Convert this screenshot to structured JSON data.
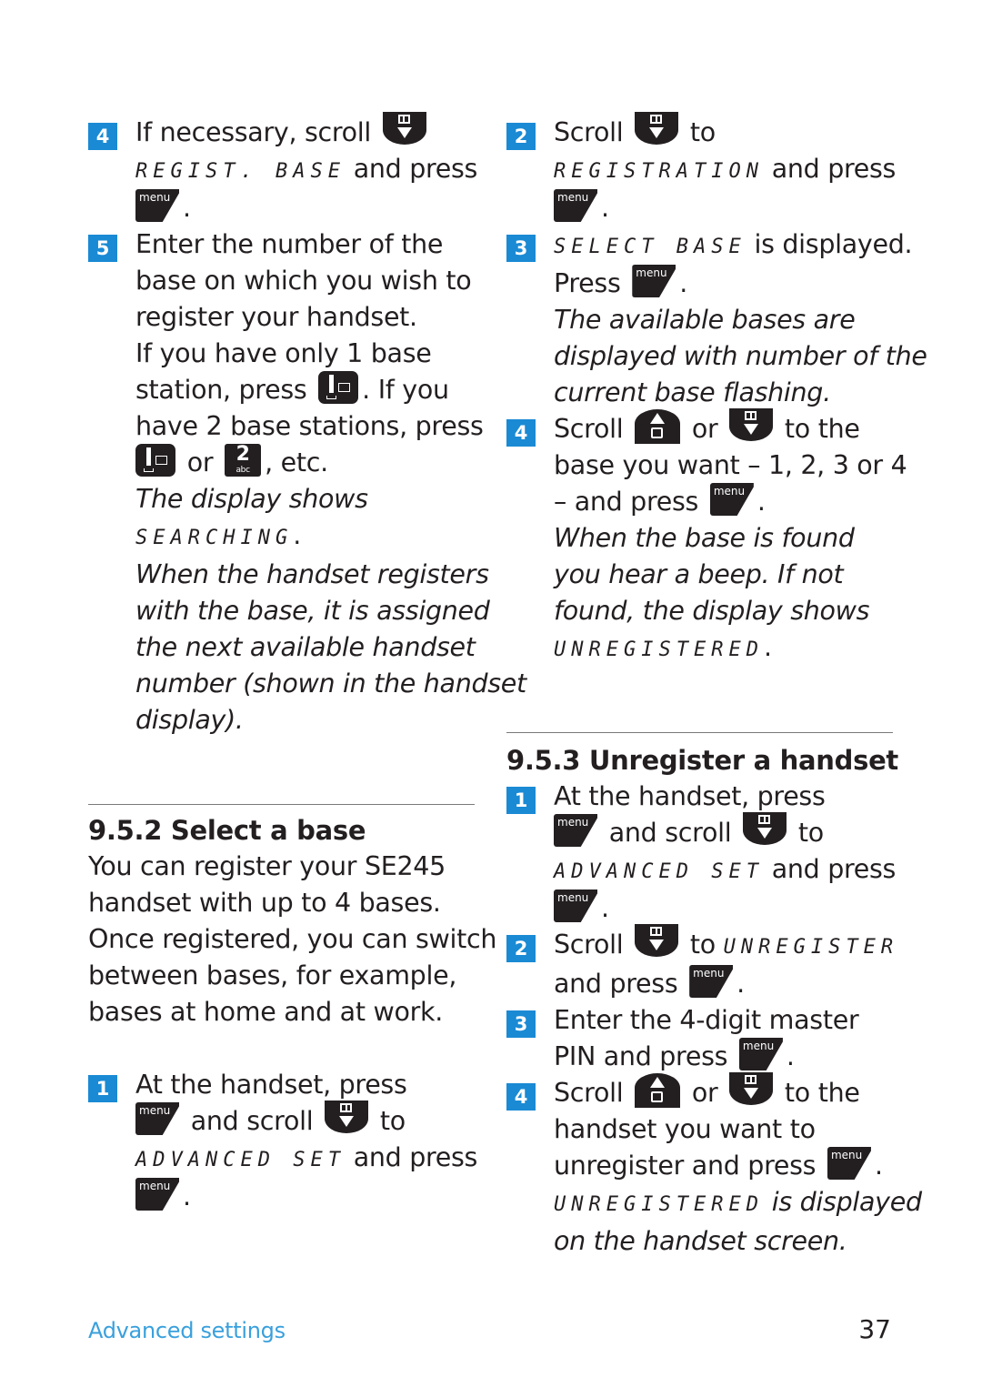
{
  "left_column": {
    "step4": {
      "number": "4",
      "line1": "If necessary, scroll",
      "lcd": "REGIST. BASE",
      "line2_tail": " and press",
      "end": "."
    },
    "step5": {
      "number": "5",
      "lines": [
        "Enter the number of the",
        "base on which you wish to",
        "register your handset.",
        "If you have only 1 base"
      ],
      "station_press": "station, press ",
      "if_you": ". If you",
      "have2": "have 2 base stations, press",
      "or": " or ",
      "etc": ", etc.",
      "key_two_num": "2",
      "key_two_sub": "abc",
      "display_shows": "The display shows",
      "lcd": "SEARCHING",
      "lcd_end": ".",
      "note_lines": [
        "When the handset registers",
        "with the base, it is assigned",
        "the next available handset",
        "number (shown in the handset",
        "display)."
      ]
    },
    "section_952": {
      "heading": "9.5.2 Select a base",
      "para_lines": [
        "You can register your SE245",
        "handset with up to 4 bases.",
        "Once registered, you can switch",
        "between bases, for example,",
        "bases at home and at work."
      ],
      "step1": {
        "number": "1",
        "line1": "At the handset, press",
        "and_scroll": " and scroll ",
        "to": " to",
        "lcd": "ADVANCED SET",
        "and_press": " and press",
        "end": "."
      }
    }
  },
  "right_column": {
    "step2": {
      "number": "2",
      "scroll": "Scroll ",
      "to": " to",
      "lcd": "REGISTRATION",
      "and_press": " and press",
      "end": "."
    },
    "step3": {
      "number": "3",
      "lcd": "SELECT BASE",
      "is_displayed": " is displayed.",
      "press": "Press ",
      "end": ".",
      "note_lines": [
        "The available bases are",
        "displayed with number of the",
        "current base flashing."
      ]
    },
    "step4": {
      "number": "4",
      "scroll": "Scroll ",
      "or": " or ",
      "to_the": " to the",
      "line2": "base you want – 1, 2, 3 or 4",
      "line3": "– and press ",
      "end": ".",
      "note_lines": [
        "When the base is found",
        "you hear a beep. If not",
        "found, the display shows"
      ],
      "lcd": "UNREGISTERED",
      "lcd_end": "."
    },
    "section_953": {
      "heading": "9.5.3 Unregister a handset",
      "step1": {
        "number": "1",
        "line1": "At the handset, press",
        "and_scroll": " and scroll ",
        "to": " to",
        "lcd": "ADVANCED SET",
        "and_press": " and press",
        "end": "."
      },
      "step2": {
        "number": "2",
        "scroll": "Scroll ",
        "to": " to ",
        "lcd": "UNREGISTER",
        "and_press": "and press ",
        "end": "."
      },
      "step3": {
        "number": "3",
        "line1": "Enter the 4-digit master",
        "line2": "PIN and press ",
        "end": "."
      },
      "step4": {
        "number": "4",
        "scroll": "Scroll ",
        "or": " or ",
        "to_the": " to the",
        "line2": "handset you want to",
        "line3": "unregister and press ",
        "end": ".",
        "lcd": "UNREGISTERED",
        "is_displayed": " is displayed",
        "last": "on the handset screen."
      }
    }
  },
  "keys": {
    "menu_label": "menu"
  },
  "footer": {
    "section": "Advanced settings",
    "page_number": "37"
  },
  "colors": {
    "badge_blue": "#1a8ad4",
    "footer_blue": "#3aa0dc",
    "text": "#231f20"
  }
}
